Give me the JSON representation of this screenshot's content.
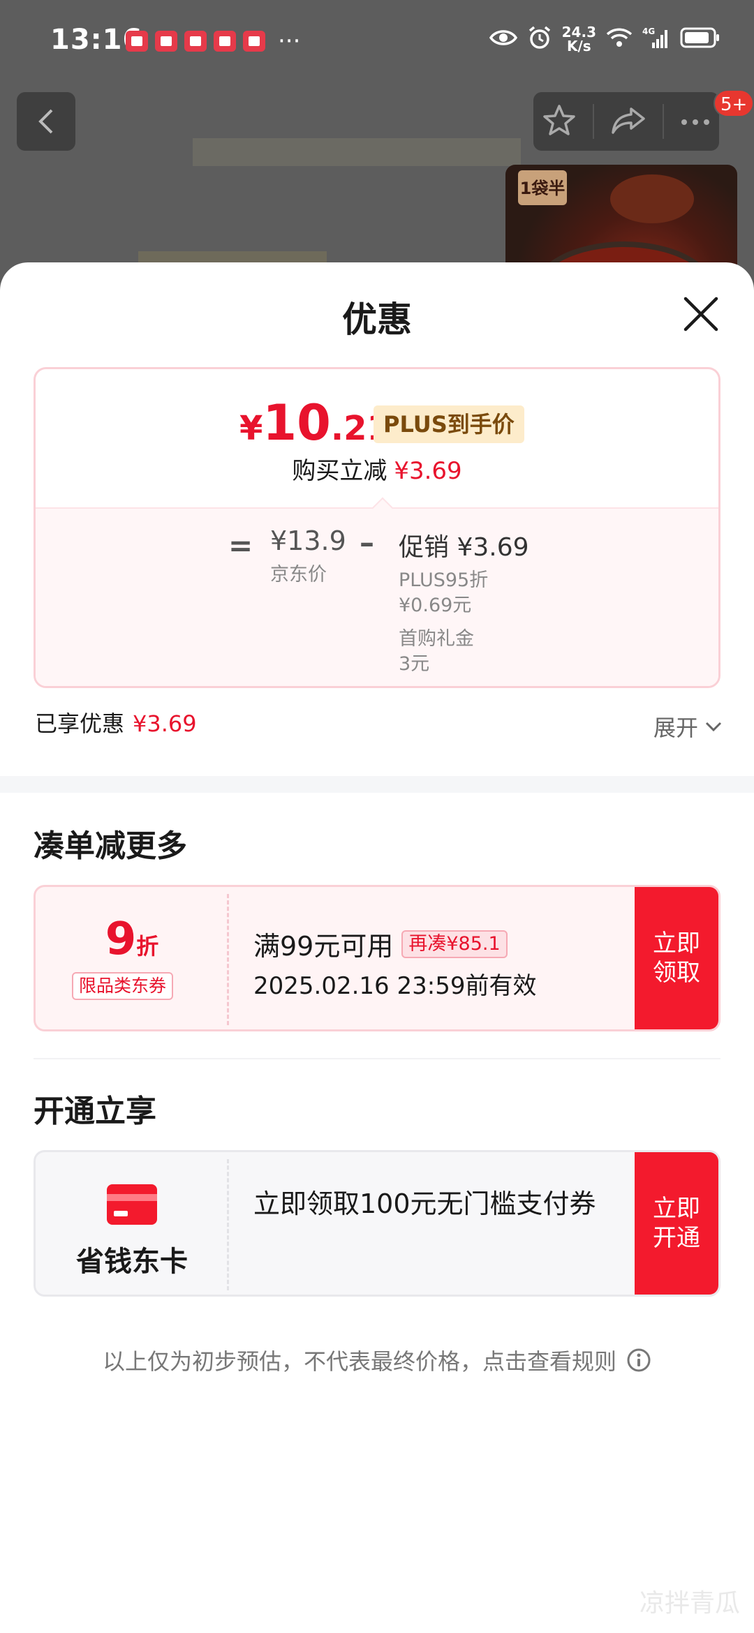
{
  "status_bar": {
    "time": "13:16",
    "more": "···",
    "speed_value": "24.3",
    "speed_unit": "K/s",
    "network": "4G"
  },
  "background_page": {
    "badge": "5+",
    "product_logo": "1袋半"
  },
  "sheet": {
    "title": "优惠",
    "price_card": {
      "currency": "¥",
      "price_int": "10",
      "price_dec": ".21",
      "price_tag": "PLUS到手价",
      "sub_label": "购买立减",
      "sub_value": "¥3.69",
      "equals": "=",
      "jd_price": "¥13.9",
      "jd_label": "京东价",
      "minus": "–",
      "promo_title": "促销 ¥3.69",
      "promo_lines": [
        "PLUS95折",
        "¥0.69元",
        "首购礼金",
        "3元"
      ]
    },
    "enjoyed_label": "已享优惠",
    "enjoyed_value": "¥3.69",
    "expand_label": "展开"
  },
  "section_more": {
    "title": "凑单减更多",
    "coupon": {
      "discount_num": "9",
      "discount_unit": "折",
      "category_tag": "限品类东券",
      "condition": "满99元可用",
      "again_tag": "再凑¥85.1",
      "validity": "2025.02.16 23:59前有效",
      "button_line1": "立即",
      "button_line2": "领取"
    }
  },
  "section_open": {
    "title": "开通立享",
    "card": {
      "name": "省钱东卡",
      "description": "立即领取100元无门槛支付券",
      "button_line1": "立即",
      "button_line2": "开通"
    }
  },
  "disclaimer": "以上仅为初步预估，不代表最终价格，点击查看规则",
  "watermark": "凉拌青瓜",
  "colors": {
    "accent_red": "#e8132d",
    "button_red": "#f31a2d",
    "plus_tag_bg": "#fdeccb",
    "plus_tag_text": "#7a4a0c"
  }
}
